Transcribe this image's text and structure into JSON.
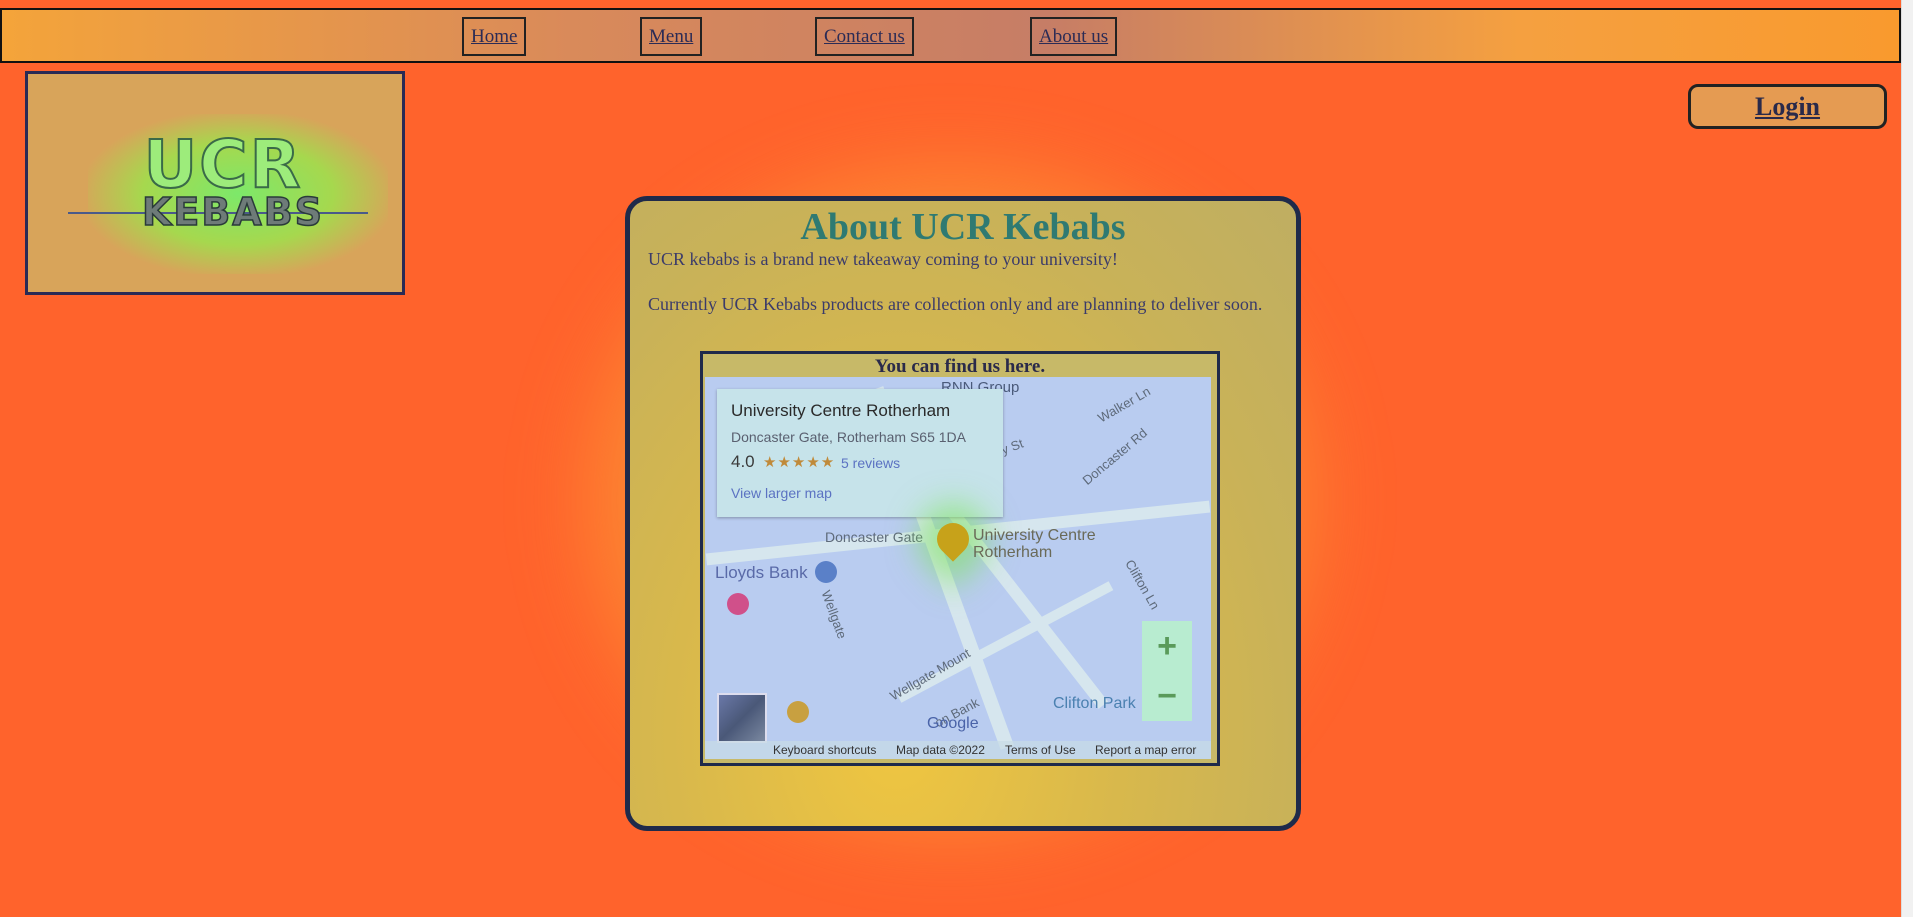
{
  "nav": {
    "items": [
      "Home",
      "Menu",
      "Contact us",
      "About us"
    ]
  },
  "logo": {
    "line1": "UCR",
    "line2": "KEBABS"
  },
  "login": {
    "label": "Login"
  },
  "about": {
    "title": "About UCR Kebabs",
    "p1": "UCR kebabs is a brand new takeaway coming to your university!",
    "p2": "Currently UCR Kebabs products are collection only and are planning to deliver soon.",
    "find_caption": "You can find us here."
  },
  "map": {
    "place_name": "University Centre Rotherham",
    "address": "Doncaster Gate, Rotherham S65 1DA",
    "rating": "4.0",
    "stars": "★★★★★",
    "reviews": "5 reviews",
    "view_larger": "View larger map",
    "pin_label_1": "University Centre",
    "pin_label_2": "Rotherham",
    "streets": {
      "rnn": "RNN Group",
      "walker": "Walker Ln",
      "doncaster_rd": "Doncaster Rd",
      "doncaster_gate": "Doncaster Gate",
      "wellgate": "Wellgate",
      "wellgate_mount": "Wellgate Mount",
      "clifton_ln": "Clifton Ln",
      "moon_bank": "on Bank",
      "y_st": "y St"
    },
    "lloyds": "Lloyds Bank",
    "clifton_park": "Clifton Park",
    "zoom_in": "+",
    "zoom_out": "−",
    "google": "Google",
    "footer": {
      "shortcuts": "Keyboard shortcuts",
      "map_data": "Map data ©2022",
      "terms": "Terms of Use",
      "report": "Report a map error"
    }
  },
  "colors": {
    "background": "#ff632c",
    "title": "#2f7a72",
    "link": "#5b72c2"
  }
}
